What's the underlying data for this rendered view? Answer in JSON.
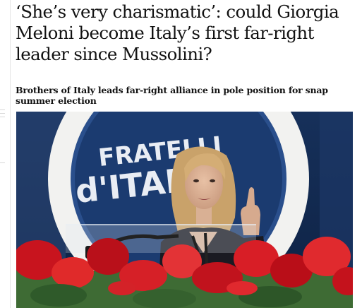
{
  "article": {
    "headline": "‘She’s very charismatic’: could Giorgia Meloni become Italy’s first far-right leader since Mussolini?",
    "standfirst": "Brothers of Italy leads far-right alliance in pole position for snap summer election"
  },
  "photo": {
    "banner_text_line1": "FRATELLI",
    "banner_text_line2": "d'ITALIA"
  }
}
